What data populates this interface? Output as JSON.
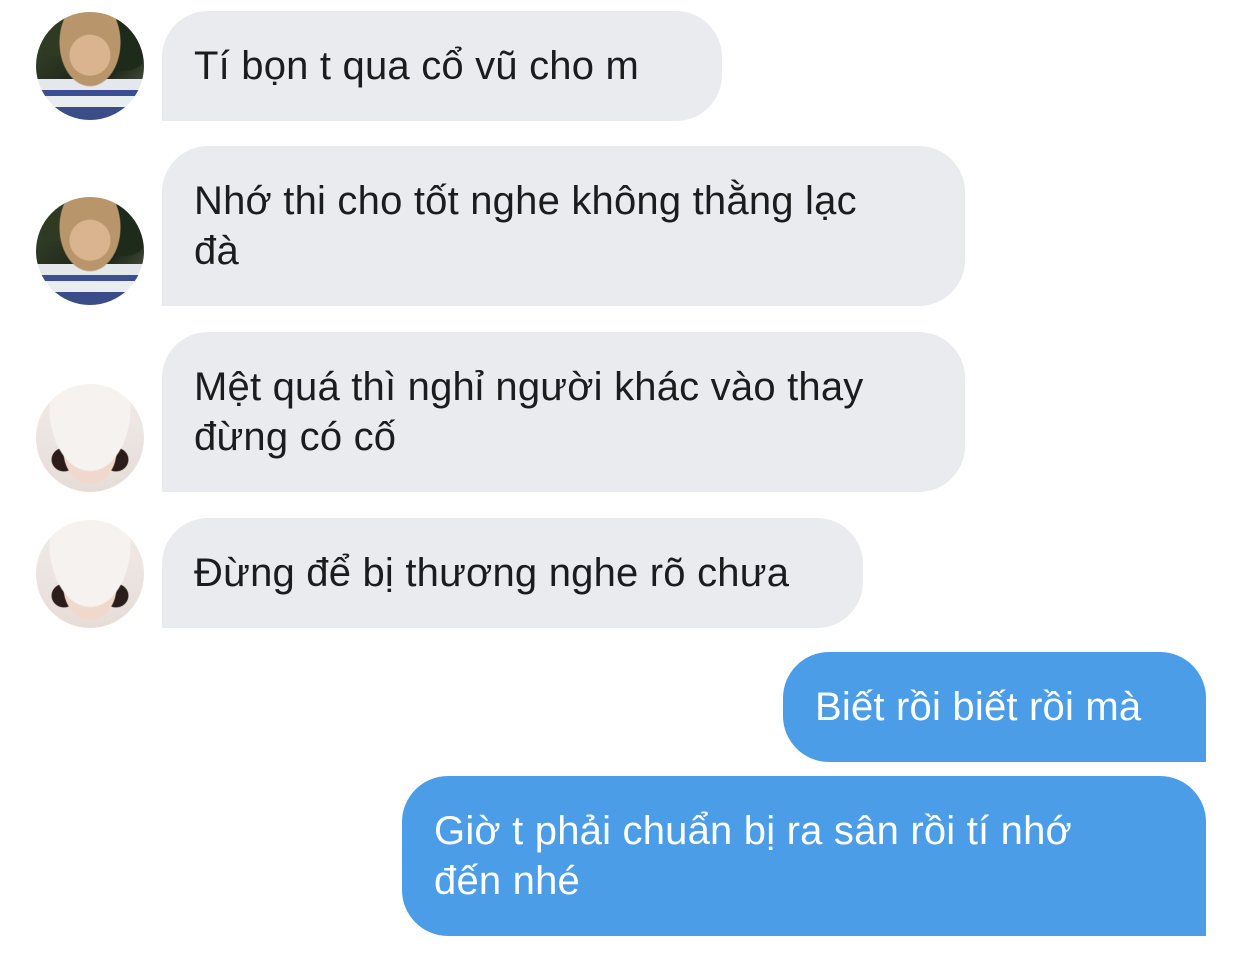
{
  "messages": [
    {
      "side": "in",
      "avatar": "a",
      "text": "Tí bọn t qua cổ vũ cho m"
    },
    {
      "side": "in",
      "avatar": "a",
      "text": "Nhớ thi cho tốt nghe không thằng lạc\nđà"
    },
    {
      "side": "in",
      "avatar": "b",
      "text": "Mệt quá thì nghỉ người khác vào thay\nđừng có cố"
    },
    {
      "side": "in",
      "avatar": "b",
      "text": "Đừng để bị thương nghe rõ chưa"
    },
    {
      "side": "out",
      "text": "Biết rồi biết rồi mà"
    },
    {
      "side": "out",
      "text": "Giờ t phải chuẩn bị ra sân rồi tí nhớ\nđến nhé"
    }
  ],
  "colors": {
    "incoming_bubble": "#e9ebef",
    "outgoing_bubble": "#4b9de8",
    "incoming_text": "#1c1c1e",
    "outgoing_text": "#ffffff"
  }
}
